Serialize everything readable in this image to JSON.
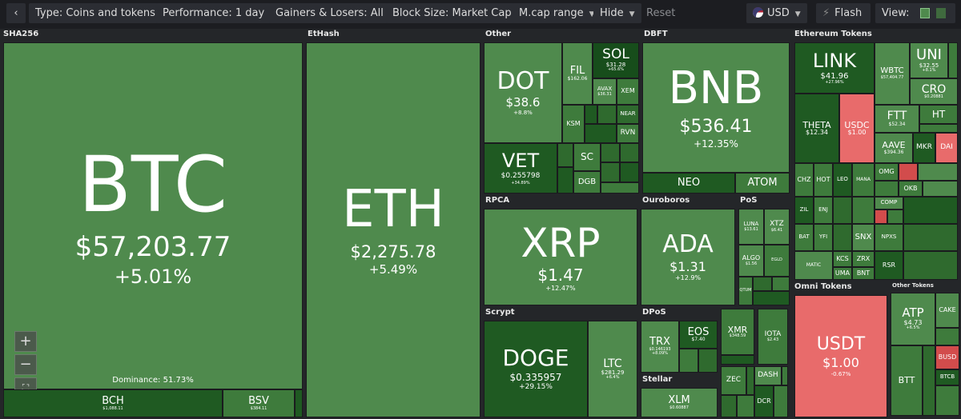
{
  "toolbar": {
    "back_icon": "chevron-left-icon",
    "type_label": "Type: Coins and tokens",
    "performance_label": "Performance: 1 day",
    "gainers_label": "Gainers & Losers: All",
    "blocksize_label": "Block Size: Market Cap",
    "mcap_label": "M.cap range",
    "hide_label": "Hide",
    "reset_label": "Reset",
    "currency_label": "USD",
    "flash_label": "Flash",
    "view_label": "View:"
  },
  "colors": {
    "gain_strong": "#1f5a22",
    "gain": "#4f8a4d",
    "loss": "#e86b6b",
    "loss_strong": "#d24c4c",
    "toolbar": "#2b2d33"
  },
  "sections": {
    "sha256": "SHA256",
    "ethash": "EtHash",
    "other": "Other",
    "dbft": "DBFT",
    "eth_tokens": "Ethereum Tokens",
    "rpca": "RPCA",
    "ouroboros": "Ouroboros",
    "pos": "PoS",
    "scrypt": "Scrypt",
    "dpos": "DPoS",
    "stellar": "Stellar",
    "omni": "Omni Tokens",
    "other_tokens": "Other Tokens"
  },
  "dominance": "Dominance: 51.73%",
  "tiles": {
    "btc": {
      "sym": "BTC",
      "price": "$57,203.77",
      "chg": "+5.01%"
    },
    "bch": {
      "sym": "BCH",
      "price": "$1,088.11"
    },
    "bsv": {
      "sym": "BSV",
      "price": "$384.11"
    },
    "eth": {
      "sym": "ETH",
      "price": "$2,275.78",
      "chg": "+5.49%"
    },
    "dot": {
      "sym": "DOT",
      "price": "$38.6",
      "chg": "+8.8%"
    },
    "fil": {
      "sym": "FIL",
      "price": "$162.06"
    },
    "sol": {
      "sym": "SOL",
      "price": "$31.28",
      "chg": "+65.6%"
    },
    "avax": {
      "sym": "AVAX",
      "price": "$36.31"
    },
    "xem": {
      "sym": "XEM"
    },
    "ksm": {
      "sym": "KSM"
    },
    "near": {
      "sym": "NEAR"
    },
    "rvn": {
      "sym": "RVN"
    },
    "vet": {
      "sym": "VET",
      "price": "$0.255798",
      "chg": "+34.89%"
    },
    "sc": {
      "sym": "SC"
    },
    "dgb": {
      "sym": "DGB"
    },
    "bnb": {
      "sym": "BNB",
      "price": "$536.41",
      "chg": "+12.35%"
    },
    "neo": {
      "sym": "NEO"
    },
    "atom": {
      "sym": "ATOM"
    },
    "link": {
      "sym": "LINK",
      "price": "$41.96",
      "chg": "+27.96%"
    },
    "wbtc": {
      "sym": "WBTC",
      "price": "$57,404.77"
    },
    "uni": {
      "sym": "UNI",
      "price": "$32.55",
      "chg": "+8.1%"
    },
    "cro": {
      "sym": "CRO",
      "price": "$0.20881"
    },
    "theta": {
      "sym": "THETA",
      "price": "$12.34"
    },
    "usdc": {
      "sym": "USDC",
      "price": "$1.00"
    },
    "ftt": {
      "sym": "FTT",
      "price": "$52.34"
    },
    "ht": {
      "sym": "HT"
    },
    "aave": {
      "sym": "AAVE",
      "price": "$394.36"
    },
    "mkr": {
      "sym": "MKR"
    },
    "dai": {
      "sym": "DAI"
    },
    "chz": {
      "sym": "CHZ"
    },
    "hot": {
      "sym": "HOT"
    },
    "leo": {
      "sym": "LEO"
    },
    "mana": {
      "sym": "MANA"
    },
    "omg": {
      "sym": "OMG"
    },
    "okb": {
      "sym": "OKB"
    },
    "comp": {
      "sym": "COMP"
    },
    "snx": {
      "sym": "SNX"
    },
    "zil": {
      "sym": "ZIL"
    },
    "enj": {
      "sym": "ENJ"
    },
    "bat": {
      "sym": "BAT"
    },
    "yfi": {
      "sym": "YFI"
    },
    "npxs": {
      "sym": "NPXS"
    },
    "zrx": {
      "sym": "ZRX"
    },
    "matic": {
      "sym": "MATIC"
    },
    "kcs": {
      "sym": "KCS"
    },
    "bnt": {
      "sym": "BNT"
    },
    "uma": {
      "sym": "UMA"
    },
    "rsr": {
      "sym": "RSR"
    },
    "xrp": {
      "sym": "XRP",
      "price": "$1.47",
      "chg": "+12.47%"
    },
    "ada": {
      "sym": "ADA",
      "price": "$1.31",
      "chg": "+12.9%"
    },
    "luna": {
      "sym": "LUNA",
      "price": "$13.61"
    },
    "xtz": {
      "sym": "XTZ",
      "price": "$6.41"
    },
    "algo": {
      "sym": "ALGO",
      "price": "$1.56"
    },
    "egld": {
      "sym": "EGLD"
    },
    "qtum": {
      "sym": "QTUM"
    },
    "doge": {
      "sym": "DOGE",
      "price": "$0.335957",
      "chg": "+29.15%"
    },
    "ltc": {
      "sym": "LTC",
      "price": "$281.29",
      "chg": "+6.4%"
    },
    "trx": {
      "sym": "TRX",
      "price": "$0.146193",
      "chg": "+8.09%"
    },
    "eos": {
      "sym": "EOS",
      "price": "$7.40"
    },
    "xmr": {
      "sym": "XMR",
      "price": "$348.59"
    },
    "iota": {
      "sym": "IOTA",
      "price": "$2.43"
    },
    "zec": {
      "sym": "ZEC"
    },
    "dash": {
      "sym": "DASH"
    },
    "dcr": {
      "sym": "DCR"
    },
    "xlm": {
      "sym": "XLM",
      "price": "$0.60887"
    },
    "usdt": {
      "sym": "USDT",
      "price": "$1.00",
      "chg": "-0.67%"
    },
    "atp": {
      "sym": "ATP",
      "price": "$4.73",
      "chg": "+6.5%"
    },
    "cake": {
      "sym": "CAKE"
    },
    "btt": {
      "sym": "BTT"
    },
    "busd": {
      "sym": "BUSD"
    },
    "btcb": {
      "sym": "BTCB"
    }
  }
}
